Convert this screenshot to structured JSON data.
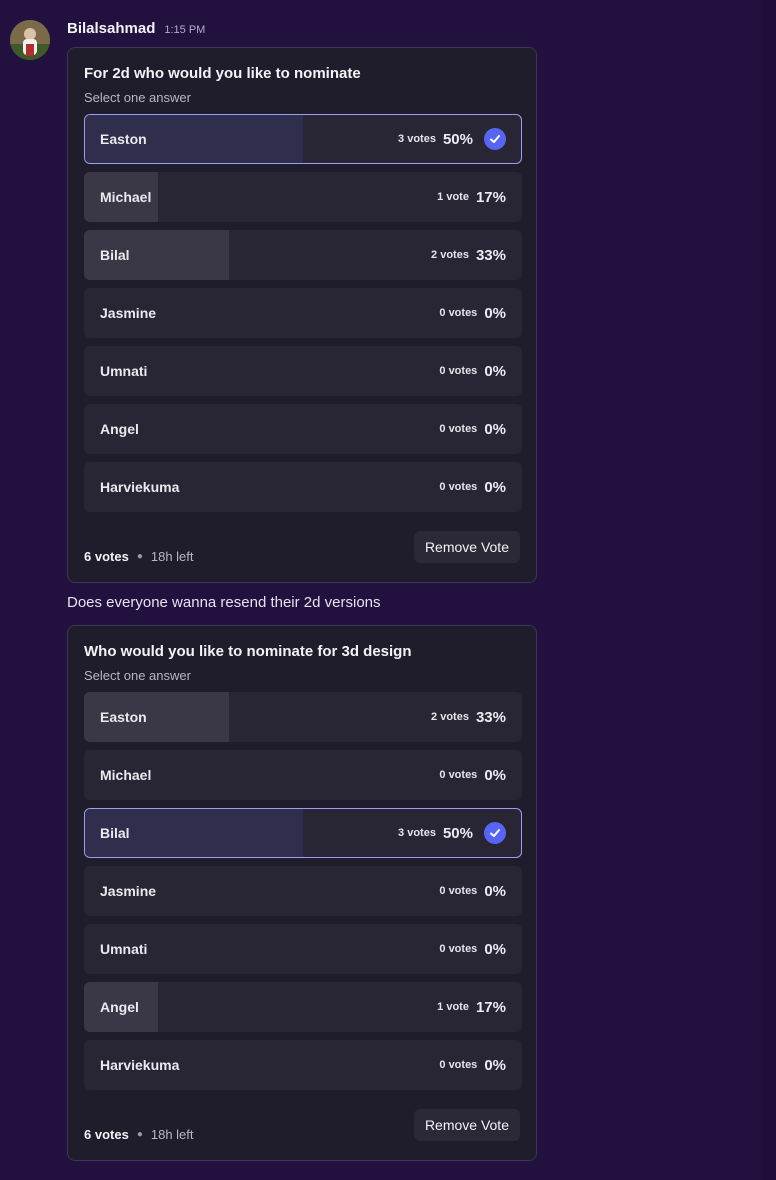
{
  "message": {
    "username": "Bilalsahmad",
    "timestamp": "1:15 PM",
    "text": "Does everyone wanna resend their 2d versions"
  },
  "polls": [
    {
      "question": "For 2d who would you like to nominate",
      "subtitle": "Select one answer",
      "total_votes": "6 votes",
      "time_left": "18h left",
      "remove_label": "Remove Vote",
      "options": [
        {
          "label": "Easton",
          "votes": "3 votes",
          "percent": "50%",
          "fraction": 0.5,
          "selected": true
        },
        {
          "label": "Michael",
          "votes": "1 vote",
          "percent": "17%",
          "fraction": 0.17,
          "selected": false
        },
        {
          "label": "Bilal",
          "votes": "2 votes",
          "percent": "33%",
          "fraction": 0.33,
          "selected": false
        },
        {
          "label": "Jasmine",
          "votes": "0 votes",
          "percent": "0%",
          "fraction": 0,
          "selected": false
        },
        {
          "label": "Umnati",
          "votes": "0 votes",
          "percent": "0%",
          "fraction": 0,
          "selected": false
        },
        {
          "label": "Angel",
          "votes": "0 votes",
          "percent": "0%",
          "fraction": 0,
          "selected": false
        },
        {
          "label": "Harviekuma",
          "votes": "0 votes",
          "percent": "0%",
          "fraction": 0,
          "selected": false
        }
      ]
    },
    {
      "question": "Who would you like to nominate for 3d design",
      "subtitle": "Select one answer",
      "total_votes": "6 votes",
      "time_left": "18h left",
      "remove_label": "Remove Vote",
      "options": [
        {
          "label": "Easton",
          "votes": "2 votes",
          "percent": "33%",
          "fraction": 0.33,
          "selected": false
        },
        {
          "label": "Michael",
          "votes": "0 votes",
          "percent": "0%",
          "fraction": 0,
          "selected": false
        },
        {
          "label": "Bilal",
          "votes": "3 votes",
          "percent": "50%",
          "fraction": 0.5,
          "selected": true
        },
        {
          "label": "Jasmine",
          "votes": "0 votes",
          "percent": "0%",
          "fraction": 0,
          "selected": false
        },
        {
          "label": "Umnati",
          "votes": "0 votes",
          "percent": "0%",
          "fraction": 0,
          "selected": false
        },
        {
          "label": "Angel",
          "votes": "1 vote",
          "percent": "17%",
          "fraction": 0.17,
          "selected": false
        },
        {
          "label": "Harviekuma",
          "votes": "0 votes",
          "percent": "0%",
          "fraction": 0,
          "selected": false
        }
      ]
    }
  ],
  "colors": {
    "background": "#22103f",
    "card": "#1f1d2c",
    "accent": "#5865f2"
  }
}
